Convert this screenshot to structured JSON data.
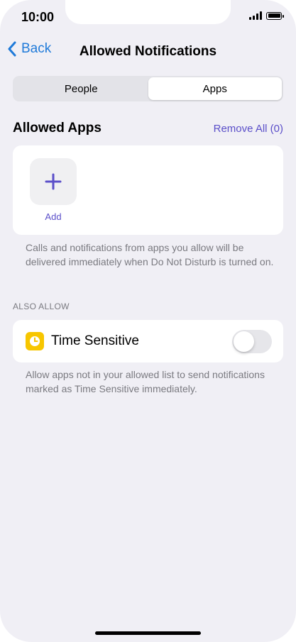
{
  "status_bar": {
    "time": "10:00"
  },
  "nav": {
    "back_label": "Back",
    "title": "Allowed Notifications"
  },
  "tabs": [
    {
      "label": "People",
      "selected": false
    },
    {
      "label": "Apps",
      "selected": true
    }
  ],
  "allowed_apps": {
    "title": "Allowed Apps",
    "remove_all_label": "Remove All (0)",
    "add_label": "Add",
    "footnote": "Calls and notifications from apps you allow will be delivered immediately when Do Not Disturb is turned on."
  },
  "also_allow": {
    "header": "ALSO ALLOW",
    "time_sensitive_label": "Time Sensitive",
    "time_sensitive_enabled": false,
    "footnote": "Allow apps not in your allowed list to send notifications marked as Time Sensitive immediately."
  },
  "icons": {
    "back": "chevron-left-icon",
    "add": "plus-icon",
    "time_sensitive": "clock-icon",
    "signal": "cellular-signal-icon",
    "battery": "battery-icon"
  },
  "colors": {
    "accent_blue": "#1f7ad9",
    "accent_purple": "#5b4fc9",
    "time_sensitive_yellow": "#f7c600",
    "background": "#f0eff5"
  }
}
